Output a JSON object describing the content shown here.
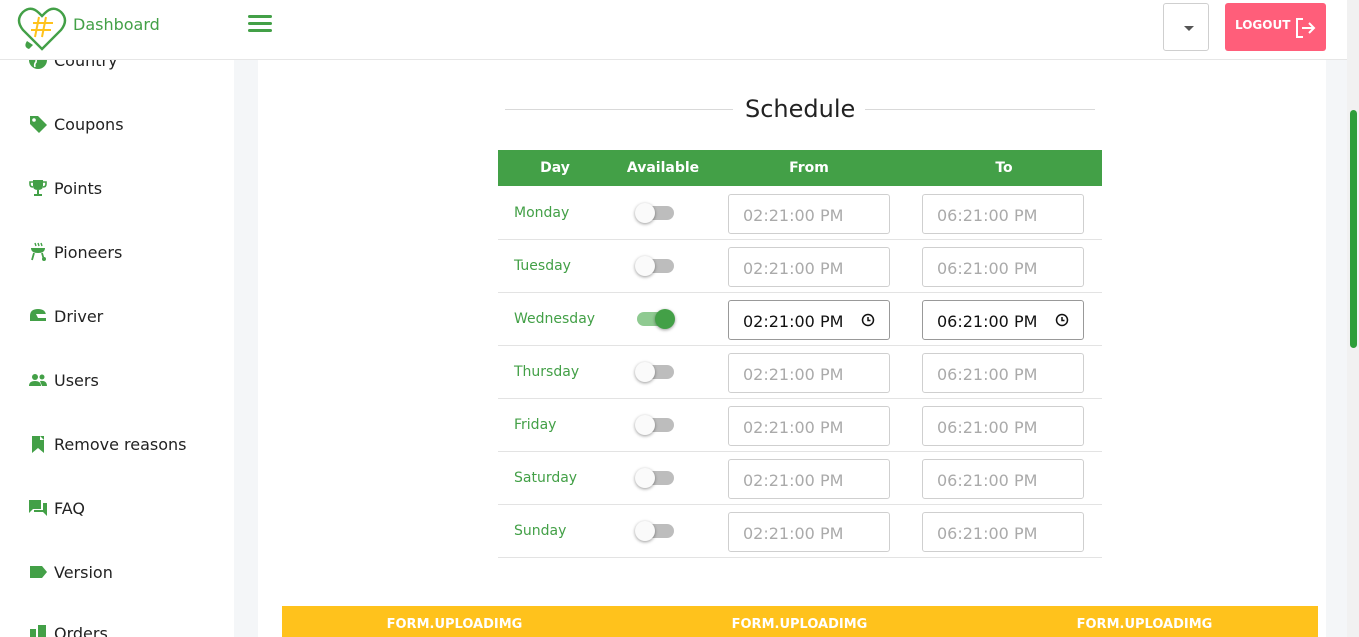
{
  "header": {
    "brand": "Dashboard",
    "logout_label": "LOGOUT"
  },
  "sidebar": {
    "items": [
      {
        "label": "Country",
        "icon": "globe-icon"
      },
      {
        "label": "Coupons",
        "icon": "tag-icon"
      },
      {
        "label": "Points",
        "icon": "trophy-icon"
      },
      {
        "label": "Pioneers",
        "icon": "grill-icon"
      },
      {
        "label": "Driver",
        "icon": "helmet-icon"
      },
      {
        "label": "Users",
        "icon": "users-icon"
      },
      {
        "label": "Remove reasons",
        "icon": "bookmark-icon"
      },
      {
        "label": "FAQ",
        "icon": "chat-icon"
      },
      {
        "label": "Version",
        "icon": "label-icon"
      },
      {
        "label": "Orders",
        "icon": "orders-icon"
      }
    ]
  },
  "schedule": {
    "title": "Schedule",
    "headers": {
      "day": "Day",
      "available": "Available",
      "from": "From",
      "to": "To"
    },
    "rows": [
      {
        "day": "Monday",
        "available": false,
        "from": "02:21:00 PM",
        "to": "06:21:00 PM"
      },
      {
        "day": "Tuesday",
        "available": false,
        "from": "02:21:00 PM",
        "to": "06:21:00 PM"
      },
      {
        "day": "Wednesday",
        "available": true,
        "from": "02:21:00 PM",
        "to": "06:21:00 PM"
      },
      {
        "day": "Thursday",
        "available": false,
        "from": "02:21:00 PM",
        "to": "06:21:00 PM"
      },
      {
        "day": "Friday",
        "available": false,
        "from": "02:21:00 PM",
        "to": "06:21:00 PM"
      },
      {
        "day": "Saturday",
        "available": false,
        "from": "02:21:00 PM",
        "to": "06:21:00 PM"
      },
      {
        "day": "Sunday",
        "available": false,
        "from": "02:21:00 PM",
        "to": "06:21:00 PM"
      }
    ]
  },
  "upload": {
    "buttons": [
      "FORM.UPLOADIMG",
      "FORM.UPLOADIMG",
      "FORM.UPLOADIMG"
    ]
  },
  "colors": {
    "primary": "#43a047",
    "logout": "#ff5e7a",
    "upload": "#ffc21c"
  }
}
